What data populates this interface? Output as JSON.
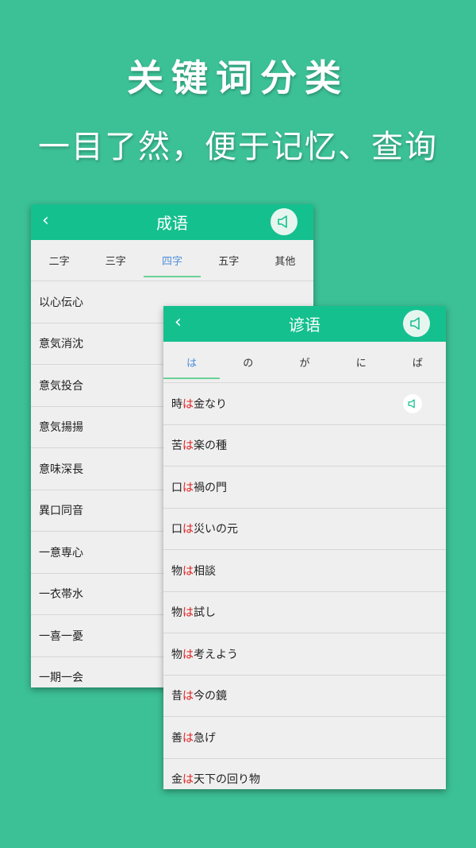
{
  "headline": "关键词分类",
  "subline": "一目了然，便于记忆、查询",
  "idiom_panel": {
    "back_glyph": "‹",
    "title": "成语",
    "tabs": [
      "二字",
      "三字",
      "四字",
      "五字",
      "其他"
    ],
    "active_tab": "四字",
    "items": [
      "以心伝心",
      "意気消沈",
      "意気投合",
      "意気揚揚",
      "意味深長",
      "異口同音",
      "一意専心",
      "一衣帯水",
      "一喜一憂",
      "一期一会"
    ]
  },
  "proverb_panel": {
    "back_glyph": "‹",
    "title": "谚语",
    "tabs": [
      "は",
      "の",
      "が",
      "に",
      "ば"
    ],
    "active_tab": "は",
    "items": [
      {
        "before": "時",
        "keyword": "は",
        "after": "金なり"
      },
      {
        "before": "苦",
        "keyword": "は",
        "after": "楽の種"
      },
      {
        "before": "口",
        "keyword": "は",
        "after": "禍の門"
      },
      {
        "before": "口",
        "keyword": "は",
        "after": "災いの元"
      },
      {
        "before": "物",
        "keyword": "は",
        "after": "相談"
      },
      {
        "before": "物",
        "keyword": "は",
        "after": "試し"
      },
      {
        "before": "物",
        "keyword": "は",
        "after": "考えよう"
      },
      {
        "before": "昔",
        "keyword": "は",
        "after": "今の鏡"
      },
      {
        "before": "善",
        "keyword": "は",
        "after": "急げ"
      },
      {
        "before": "金",
        "keyword": "は",
        "after": "天下の回り物"
      }
    ]
  },
  "icons": {
    "back": "chevron-left-icon",
    "speaker": "speaker-icon"
  },
  "colors": {
    "background": "#3cc095",
    "bar": "#15c08f",
    "active_tab_text": "#4f8fdc",
    "active_tab_underline": "#6bd196",
    "keyword": "#e02020"
  }
}
